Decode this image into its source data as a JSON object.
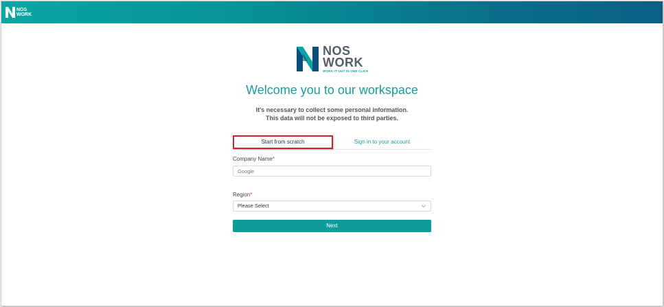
{
  "header": {
    "logo_text_line1": "NOS",
    "logo_text_line2": "WORK"
  },
  "brand": {
    "name_line1": "NOS",
    "name_line2": "WORK",
    "tagline": "WORK IT OUT IN ONE CLICK"
  },
  "page": {
    "title": "Welcome you to our workspace",
    "subtitle_line1": "It's necessary to collect some personal information.",
    "subtitle_line2": "This data will not be exposed to third parties."
  },
  "tabs": [
    {
      "label": "Start from scratch",
      "active": true
    },
    {
      "label": "Sign in to your account",
      "active": false
    }
  ],
  "form": {
    "company_label": "Company Name",
    "company_required": "*",
    "company_placeholder": "Google",
    "region_label": "Region",
    "region_required": "*",
    "region_selected": "Please Select",
    "next_label": "Next"
  },
  "colors": {
    "accent": "#0c9c9b",
    "title": "#159e9c",
    "highlight": "#c62828",
    "required": "#d32f2f"
  }
}
